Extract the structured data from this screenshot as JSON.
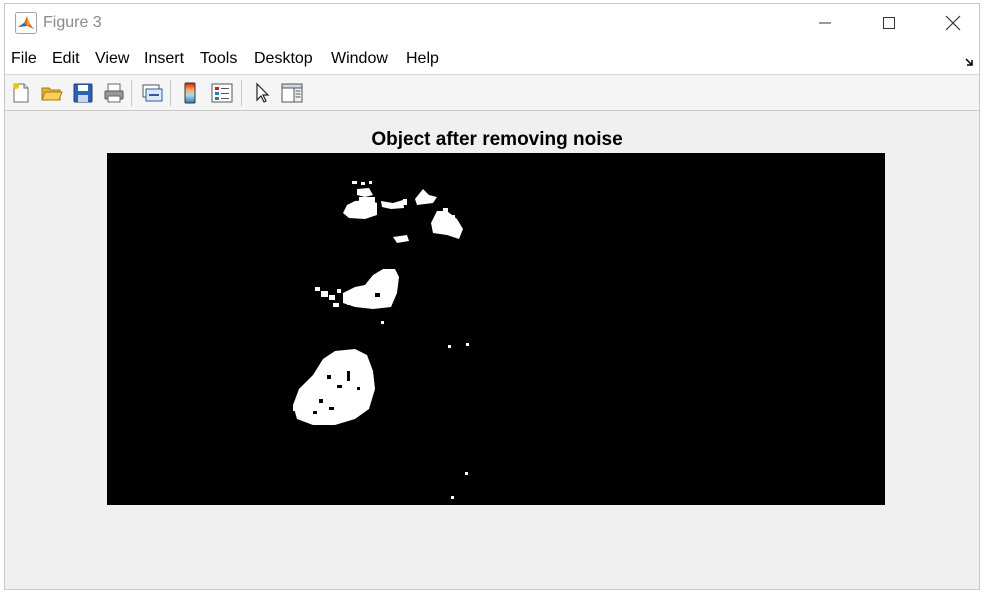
{
  "window": {
    "title": "Figure 3"
  },
  "menu": [
    "File",
    "Edit",
    "View",
    "Insert",
    "Tools",
    "Desktop",
    "Window",
    "Help"
  ],
  "toolbar": {
    "icons": [
      "new-figure-icon",
      "open-file-icon",
      "save-icon",
      "print-icon",
      "link-plot-icon",
      "insert-colorbar-icon",
      "insert-legend-icon",
      "edit-plot-icon",
      "property-inspector-icon"
    ]
  },
  "axes": {
    "title": "Object after removing noise"
  },
  "colors": {
    "image_background": "#000000",
    "foreground": "#ffffff",
    "figure_background": "#f0f0f0"
  }
}
